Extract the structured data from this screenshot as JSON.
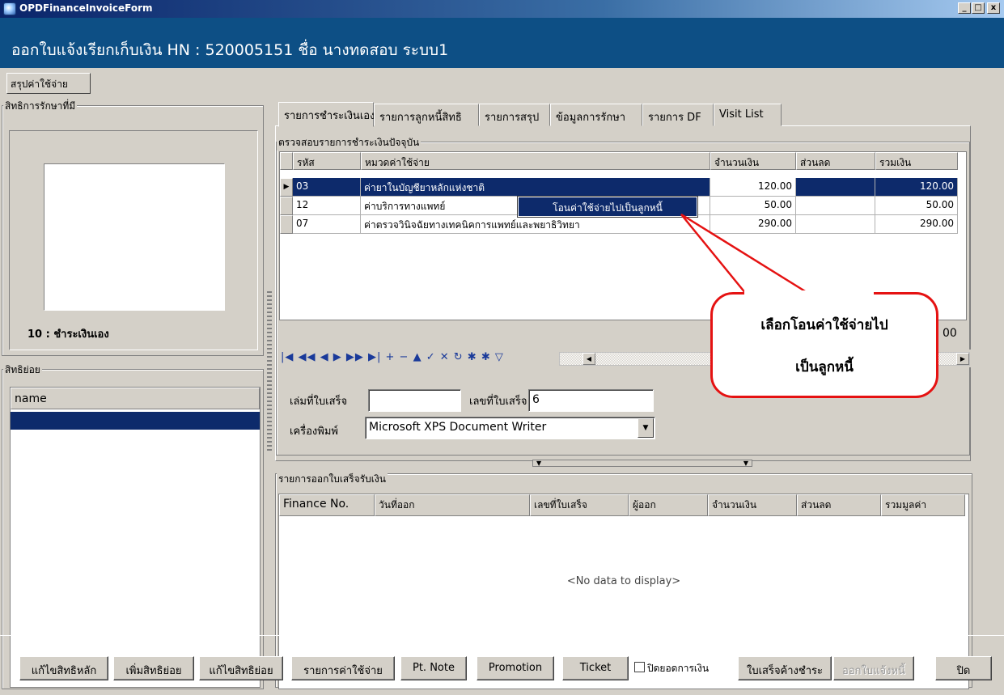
{
  "window": {
    "title": "OPDFinanceInvoiceForm",
    "controls": [
      "_",
      "□",
      "x"
    ]
  },
  "header": {
    "text": "ออกใบแจ้งเรียกเก็บเงิน HN : 520005151 ชื่อ นางทดสอบ  ระบบ1"
  },
  "summary_tab": "สรุปค่าใช้จ่าย",
  "left": {
    "rights_label": "สิทธิการรักษาที่มี",
    "right_caption": "10 : ชำระเงินเอง",
    "sub_label": "สิทธิย่อย",
    "sub_header": "name"
  },
  "tabs": [
    "รายการชำระเงินเอง",
    "รายการลูกหนี้สิทธิ",
    "รายการสรุป",
    "ข้อมูลการรักษา",
    "รายการ DF",
    "Visit List"
  ],
  "check_section": "ตรวจสอบรายการชำระเงินปัจจุบัน",
  "grid": {
    "headers": [
      "รหัส",
      "หมวดค่าใช้จ่าย",
      "จำนวนเงิน",
      "ส่วนลด",
      "รวมเงิน"
    ],
    "rows": [
      {
        "code": "03",
        "category": "ค่ายาในบัญชียาหลักแห่งชาติ",
        "amount": "120.00",
        "discount": "",
        "total": "120.00"
      },
      {
        "code": "12",
        "category": "ค่าบริการทางแพทย์",
        "amount": "50.00",
        "discount": "",
        "total": "50.00"
      },
      {
        "code": "07",
        "category": "ค่าตรวจวินิจฉัยทางเทคนิคการแพทย์และพยาธิวิทยา",
        "amount": "290.00",
        "discount": "",
        "total": "290.00"
      }
    ],
    "footer_partial": "00"
  },
  "navigator": {
    "buttons": "|◀ ◀◀ ◀ ▶ ▶▶ ▶| + − ▲ ✓ ✕ ↻ ✱ ✱ ▽"
  },
  "form": {
    "book_label": "เล่มที่ใบเสร็จ",
    "book_value": "",
    "number_label": "เลขที่ใบเสร็จ",
    "number_value": "6",
    "printer_label": "เครื่องพิมพ์",
    "printer_value": "Microsoft XPS Document Writer"
  },
  "context_menu": {
    "item": "โอนค่าใช้จ่ายไปเป็นลูกหนี้"
  },
  "callout": {
    "line1": "เลือกโอนค่าใช้จ่ายไป",
    "line2": "เป็นลูกหนี้"
  },
  "receipts": {
    "label": "รายการออกใบเสร็จรับเงิน",
    "headers": [
      "Finance No.",
      "วันที่ออก",
      "เลขที่ใบเสร็จ",
      "ผู้ออก",
      "จำนวนเงิน",
      "ส่วนลด",
      "รวมมูลค่า"
    ],
    "empty_text": "<No data to display>"
  },
  "buttons": {
    "edit_main": "แก้ไขสิทธิหลัก",
    "add_sub": "เพิ่มสิทธิย่อย",
    "edit_sub": "แก้ไขสิทธิย่อย",
    "expenses": "รายการค่าใช้จ่าย",
    "pt_note": "Pt. Note",
    "promotion": "Promotion",
    "ticket": "Ticket",
    "close_balance": "ปิดยอดการเงิน",
    "pending_receipt": "ใบเสร็จค้างชำระ",
    "issue_invoice": "ออกใบแจ้งหนี้",
    "close": "ปิด"
  },
  "colors": {
    "header_bg": "#0d4f85",
    "selection": "#0d2a6b",
    "callout_border": "#e51212"
  }
}
